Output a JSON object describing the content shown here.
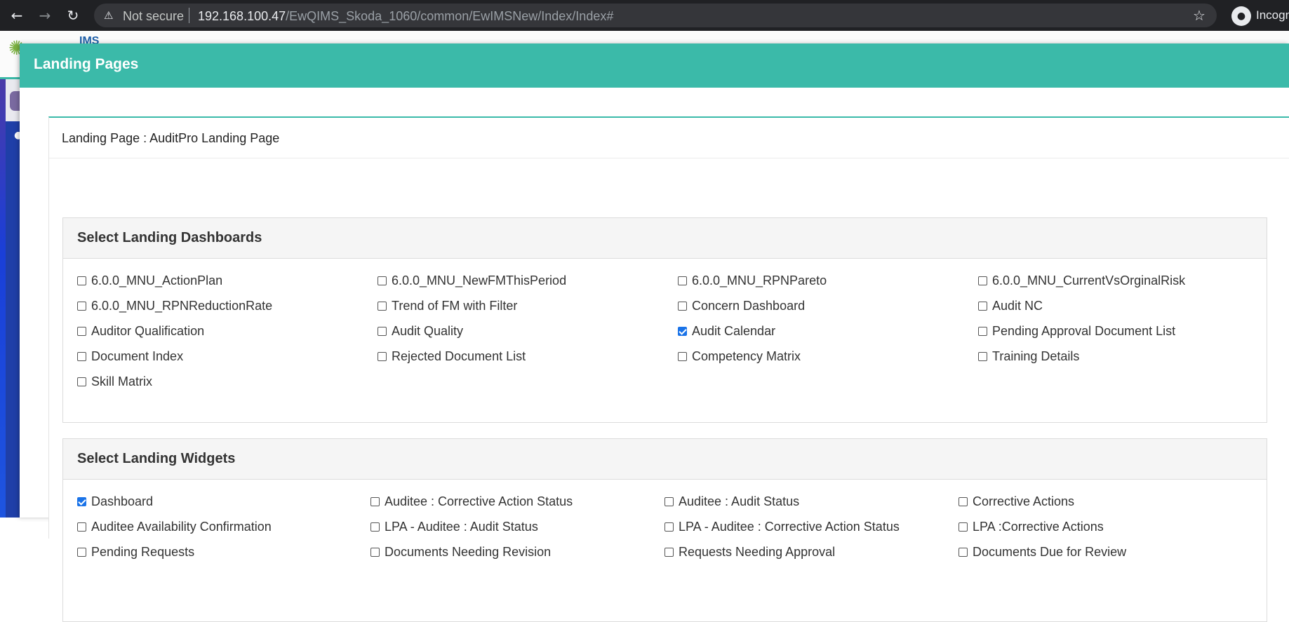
{
  "browser": {
    "not_secure_label": "Not secure",
    "url_host": "192.168.100.47",
    "url_path": "/EwQIMS_Skoda_1060/common/EwIMSNew/Index/Index#",
    "profile_label": "Incognito",
    "icons": [
      "back-icon",
      "forward-icon",
      "reload-icon",
      "warning-icon",
      "star-icon",
      "incognito-icon"
    ]
  },
  "app": {
    "logo_text": "IMS"
  },
  "modal": {
    "title": "Landing Pages",
    "landing_page_label": "Landing Page : AuditPro Landing Page",
    "accent_color": "#3bbaa9"
  },
  "dashboards": {
    "title": "Select Landing Dashboards",
    "items": [
      {
        "label": "6.0.0_MNU_ActionPlan",
        "checked": false
      },
      {
        "label": "6.0.0_MNU_NewFMThisPeriod",
        "checked": false
      },
      {
        "label": "6.0.0_MNU_RPNPareto",
        "checked": false
      },
      {
        "label": "6.0.0_MNU_CurrentVsOrginalRisk",
        "checked": false
      },
      {
        "label": "6.0.0_MNU_RPNReductionRate",
        "checked": false
      },
      {
        "label": "Trend of FM with Filter",
        "checked": false
      },
      {
        "label": "Concern Dashboard",
        "checked": false
      },
      {
        "label": "Audit NC",
        "checked": false
      },
      {
        "label": "Auditor Qualification",
        "checked": false
      },
      {
        "label": "Audit Quality",
        "checked": false
      },
      {
        "label": "Audit Calendar",
        "checked": true
      },
      {
        "label": "Pending Approval Document List",
        "checked": false
      },
      {
        "label": "Document Index",
        "checked": false
      },
      {
        "label": "Rejected Document List",
        "checked": false
      },
      {
        "label": "Competency Matrix",
        "checked": false
      },
      {
        "label": "Training Details",
        "checked": false
      },
      {
        "label": "Skill Matrix",
        "checked": false
      }
    ]
  },
  "widgets": {
    "title": "Select Landing Widgets",
    "items": [
      {
        "label": "Dashboard",
        "checked": true
      },
      {
        "label": "Auditee : Corrective Action Status",
        "checked": false
      },
      {
        "label": "Auditee : Audit Status",
        "checked": false
      },
      {
        "label": "Corrective Actions",
        "checked": false
      },
      {
        "label": "Auditee Availability Confirmation",
        "checked": false
      },
      {
        "label": "LPA - Auditee : Audit Status",
        "checked": false
      },
      {
        "label": "LPA - Auditee : Corrective Action Status",
        "checked": false
      },
      {
        "label": "LPA :Corrective Actions",
        "checked": false
      },
      {
        "label": "Pending Requests",
        "checked": false
      },
      {
        "label": "Documents Needing Revision",
        "checked": false
      },
      {
        "label": "Requests Needing Approval",
        "checked": false
      },
      {
        "label": "Documents Due for Review",
        "checked": false
      }
    ]
  }
}
